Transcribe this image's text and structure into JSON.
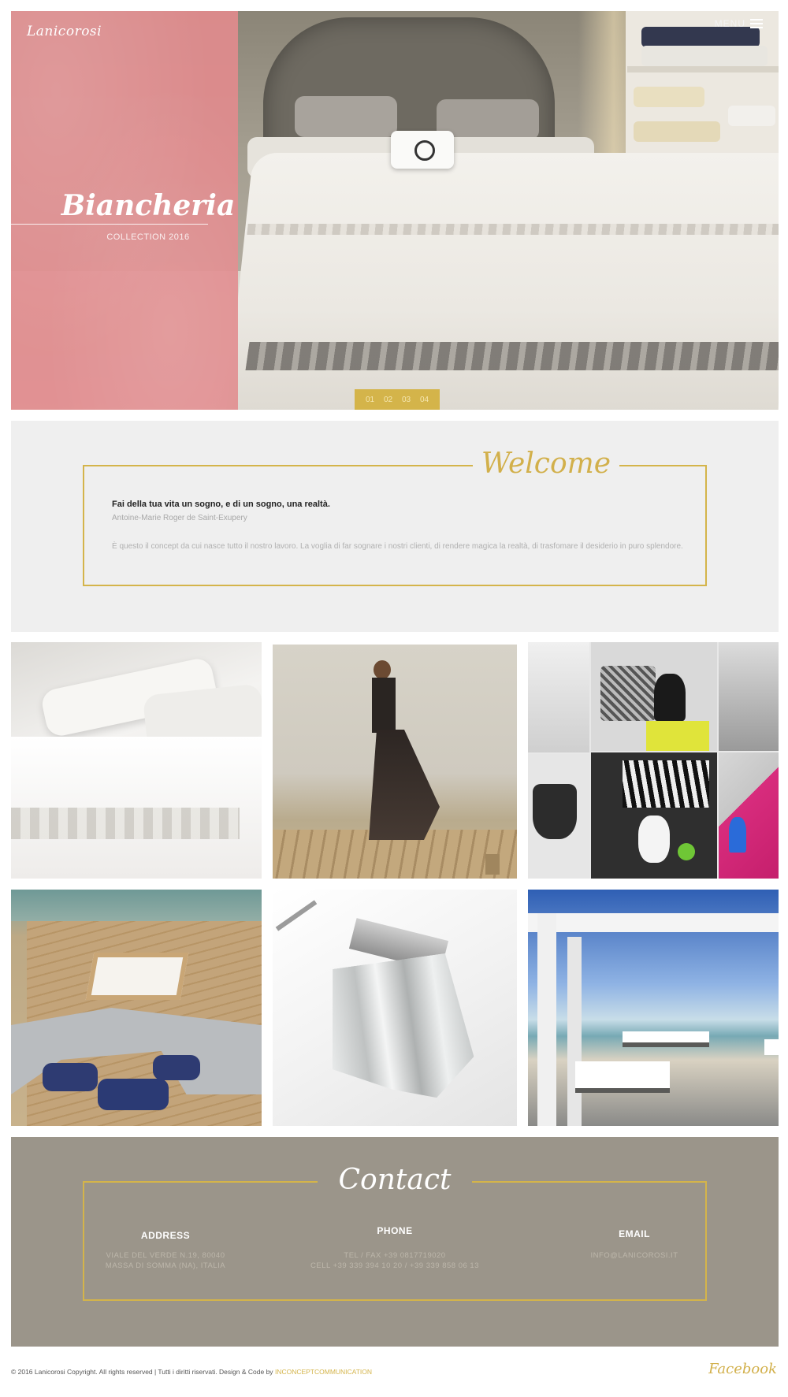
{
  "brand": {
    "logo_text": "Lanicorosi",
    "accent_color": "#d4b44a",
    "hero_panel_color": "#e08b8d",
    "contact_bg_color": "#9b958a"
  },
  "header": {
    "menu_label": "MENU",
    "menu_icon": "hamburger-icon"
  },
  "hero": {
    "title": "Biancheria",
    "subtitle": "COLLECTION 2016",
    "slides": [
      "01",
      "02",
      "03",
      "04"
    ]
  },
  "welcome": {
    "title": "Welcome",
    "quote": "Fai della tua vita un sogno, e di un sogno, una realtà.",
    "author": "Antoine-Marie Roger de Saint-Exupery",
    "body": "È questo il concept da cui nasce tutto il nostro lavoro. La voglia di far sognare i nostri clienti, di rendere magica la realtà, di trasfomare il desiderio in puro splendore."
  },
  "gallery": {
    "tiles": [
      "bed-linen-photo",
      "woman-dress-photo",
      "interior-collage-photo",
      "yacht-deck-photo",
      "crystal-chandelier-photo",
      "beach-cabana-photo"
    ]
  },
  "contact": {
    "title": "Contact",
    "address": {
      "heading": "ADDRESS",
      "line1": "VIALE DEL VERDE N.19, 80040",
      "line2": "MASSA DI SOMMA (NA), ITALIA"
    },
    "phone": {
      "heading": "PHONE",
      "line1": "TEL / FAX +39 0817719020",
      "line2": "CELL +39 339 394 10 20 / +39 339 858 06 13"
    },
    "email": {
      "heading": "EMAIL",
      "line1": "INFO@LANICOROSI.IT"
    }
  },
  "footer": {
    "copyright": "© 2016 Lanicorosi Copyright. All rights reserved | Tutti i diritti riservati. Design & Code by",
    "credit_link": "INCONCEPTCOMMUNICATION",
    "social": "Facebook"
  }
}
